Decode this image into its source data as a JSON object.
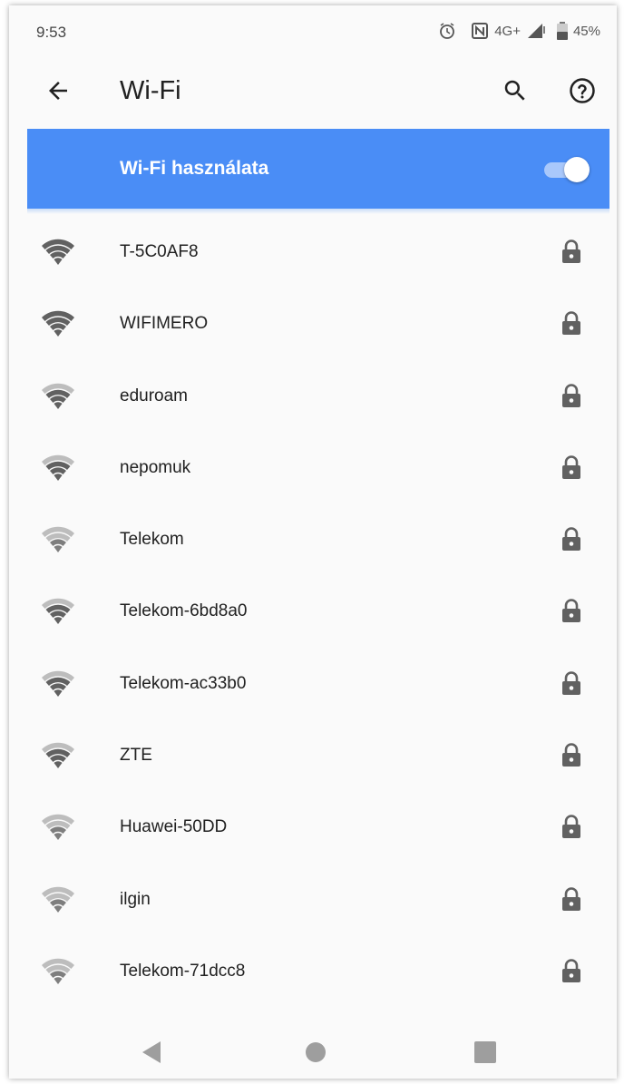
{
  "status_bar": {
    "time": "9:53",
    "network_type": "4G+",
    "battery_percent": "45%",
    "icons": [
      "alarm-icon",
      "nfc-icon",
      "signal-icon",
      "battery-icon"
    ]
  },
  "toolbar": {
    "title": "Wi-Fi",
    "back_icon": "arrow-back-icon",
    "search_icon": "search-icon",
    "help_icon": "help-icon"
  },
  "master_switch": {
    "label": "Wi-Fi használata",
    "enabled": true,
    "color": "#4a8df6"
  },
  "networks": [
    {
      "ssid": "T-5C0AF8",
      "signal": 4,
      "secured": true
    },
    {
      "ssid": "WIFIMERO",
      "signal": 4,
      "secured": true
    },
    {
      "ssid": "eduroam",
      "signal": 3,
      "secured": true
    },
    {
      "ssid": "nepomuk",
      "signal": 3,
      "secured": true
    },
    {
      "ssid": "Telekom",
      "signal": 2,
      "secured": true
    },
    {
      "ssid": "Telekom-6bd8a0",
      "signal": 3,
      "secured": true
    },
    {
      "ssid": "Telekom-ac33b0",
      "signal": 3,
      "secured": true
    },
    {
      "ssid": "ZTE",
      "signal": 3,
      "secured": true
    },
    {
      "ssid": "Huawei-50DD",
      "signal": 2,
      "secured": true
    },
    {
      "ssid": "ilgin",
      "signal": 2,
      "secured": true
    },
    {
      "ssid": "Telekom-71dcc8",
      "signal": 2,
      "secured": true
    }
  ],
  "nav_bar": {
    "icons": [
      "nav-back-icon",
      "nav-home-icon",
      "nav-recents-icon"
    ]
  }
}
